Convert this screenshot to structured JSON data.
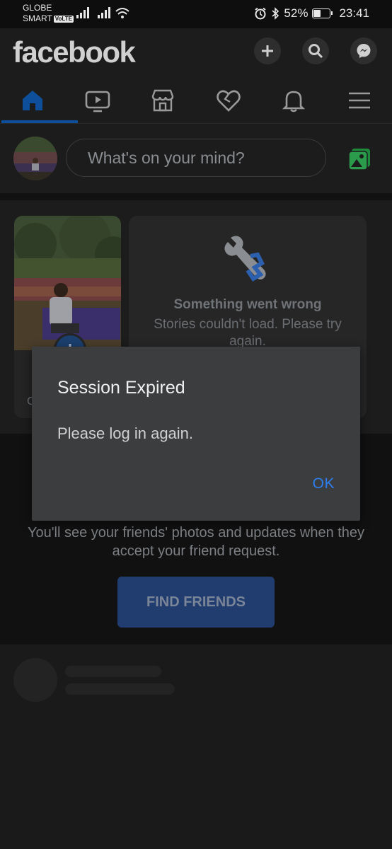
{
  "status_bar": {
    "carrier_line1": "GLOBE",
    "carrier_line2": "SMART",
    "volte": "VoLTE",
    "battery": "52%",
    "battery_level": 0.52,
    "time": "23:41"
  },
  "header": {
    "logo": "facebook",
    "actions": [
      "plus-icon",
      "search-icon",
      "messenger-icon"
    ],
    "tabs": [
      "home-icon",
      "video-icon",
      "marketplace-icon",
      "dating-icon",
      "bell-icon",
      "menu-icon"
    ],
    "active_tab": "home"
  },
  "composer": {
    "placeholder": "What's on your mind?",
    "photo_icon": "photo-icon"
  },
  "stories": {
    "error_title": "Something went wrong",
    "error_message": "Stories couldn't load. Please try again."
  },
  "friends": {
    "message": "You'll see your friends' photos and updates when they accept your friend request.",
    "button": "FIND FRIENDS"
  },
  "dialog": {
    "title": "Session Expired",
    "message": "Please log in again.",
    "ok": "OK"
  },
  "colors": {
    "brand": "#1877f2",
    "dialog_bg": "#3c3d3f",
    "ok": "#2d7ff0"
  }
}
